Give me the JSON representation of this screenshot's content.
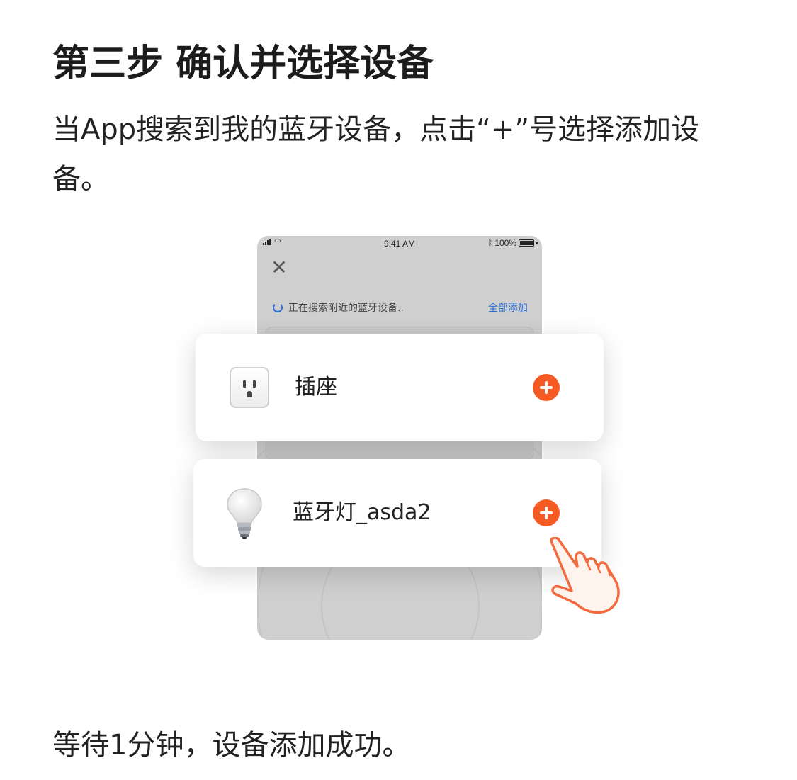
{
  "page": {
    "title": "第三步 确认并选择设备",
    "description": "当App搜索到我的蓝牙设备，点击“+”号选择添加设备。",
    "footer": "等待1分钟，设备添加成功。"
  },
  "phone": {
    "status_bar": {
      "time": "9:41 AM",
      "battery": "100%"
    },
    "close_icon": "close-icon",
    "search_status": "正在搜索附近的蓝牙设备..",
    "add_all_label": "全部添加"
  },
  "devices": [
    {
      "name": "插座",
      "icon": "socket-icon"
    },
    {
      "name": "蓝牙灯_asda2",
      "icon": "bulb-icon"
    }
  ],
  "colors": {
    "accent": "#f55a22",
    "link_blue": "#2e6fd6",
    "phone_bg": "#cfcfcf",
    "hand_stroke": "#f26a3d"
  }
}
